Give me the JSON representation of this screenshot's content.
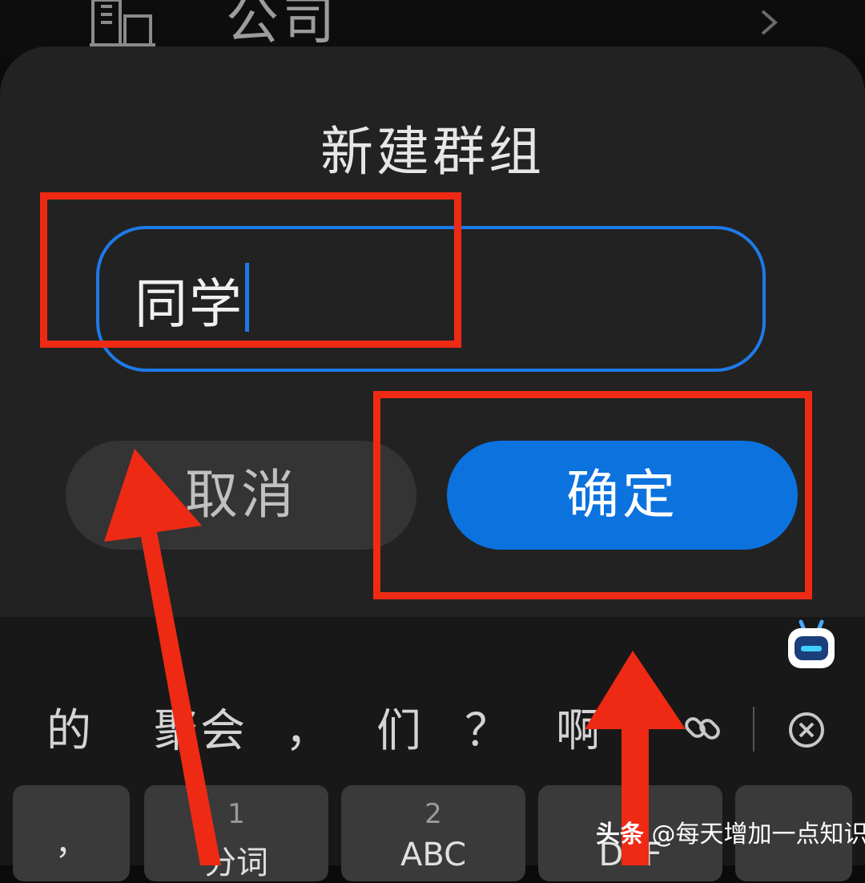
{
  "background_row": {
    "label": "公司"
  },
  "dialog": {
    "title": "新建群组",
    "input_value": "同学",
    "cancel_label": "取消",
    "confirm_label": "确定"
  },
  "keyboard": {
    "candidates": [
      "的",
      "聚会",
      "，",
      "们",
      "？",
      "啊"
    ],
    "keys": [
      {
        "num": "",
        "label": "，"
      },
      {
        "num": "1",
        "label": "分词"
      },
      {
        "num": "2",
        "label": "ABC"
      },
      {
        "num": "3",
        "label": "DEF"
      },
      {
        "num": "",
        "label": ""
      }
    ]
  },
  "watermark": {
    "brand": "头条",
    "text": "@每天增加一点知识"
  },
  "colors": {
    "accent": "#0b72de",
    "annotation": "#ee2a14",
    "dialog_bg": "#222222"
  },
  "icons": [
    "building-icon",
    "chevron-right-icon",
    "keyboard-bot-icon",
    "link-icon",
    "delete-icon"
  ]
}
